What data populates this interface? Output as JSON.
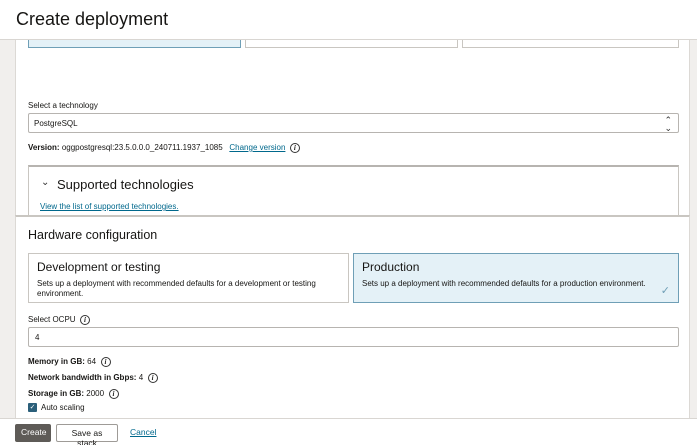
{
  "header": {
    "title": "Create deployment"
  },
  "technology": {
    "label": "Select a technology",
    "selected": "PostgreSQL"
  },
  "version": {
    "label": "Version:",
    "value": "oggpostgresql:23.5.0.0.0_240711.1937_1085",
    "change_link": "Change version"
  },
  "supported": {
    "title": "Supported technologies",
    "link": "View the list of supported technologies."
  },
  "hardware": {
    "title": "Hardware configuration",
    "options": [
      {
        "title": "Development or testing",
        "desc": "Sets up a deployment with recommended defaults for a development or testing environment.",
        "selected": false
      },
      {
        "title": "Production",
        "desc": "Sets up a deployment with recommended defaults for a production environment.",
        "selected": true
      }
    ],
    "ocpu_label": "Select OCPU",
    "ocpu_value": "4",
    "memory_label": "Memory in GB:",
    "memory_value": "64",
    "bandwidth_label": "Network bandwidth in Gbps:",
    "bandwidth_value": "4",
    "storage_label": "Storage in GB:",
    "storage_value": "2000",
    "autoscaling_label": "Auto scaling",
    "autoscaling_checked": true
  },
  "footer": {
    "create": "Create",
    "save_stack": "Save as stack",
    "cancel": "Cancel"
  },
  "icons": {
    "info": "info-icon",
    "chevron": "chevron-down-icon",
    "select": "up-down-chevron-icon",
    "check": "checkmark-icon"
  },
  "colors": {
    "accent": "#00688c",
    "selected_card_bg": "#e4f1f7",
    "primary_button": "#5e5b57"
  }
}
